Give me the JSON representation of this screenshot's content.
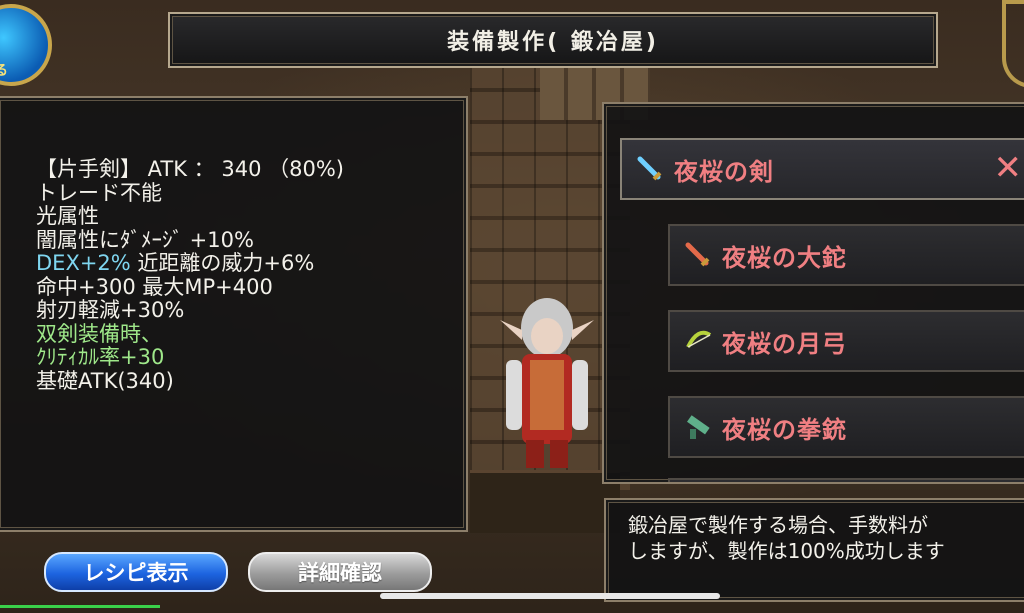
{
  "header": {
    "title": "装備製作( 鍛冶屋)"
  },
  "back_button": {
    "label": "る"
  },
  "item_info": {
    "lines": [
      {
        "text": "【片手剣】 ATK ： 340 （80%)",
        "color": "white"
      },
      {
        "text": "トレード不能",
        "color": "white"
      },
      {
        "text": "光属性",
        "color": "white"
      },
      {
        "text": "闇属性にﾀﾞﾒｰｼﾞ +10%",
        "color": "white"
      },
      {
        "text_a": "DEX+2%",
        "text_b": " 近距離の威力+6%",
        "color": "cyan+white"
      },
      {
        "text": "命中+300 最大MP+400",
        "color": "white"
      },
      {
        "text": "射刃軽減+30%",
        "color": "white"
      },
      {
        "text": "双剣装備時、",
        "color": "green"
      },
      {
        "text": "ｸﾘﾃｨｶﾙ率+30",
        "color": "green"
      },
      {
        "text": "基礎ATK(340)",
        "color": "white"
      }
    ]
  },
  "recipe_list": {
    "items": [
      {
        "label": "夜桜の剣",
        "icon": "sword-icon",
        "selected": true
      },
      {
        "label": "夜桜の大鉈",
        "icon": "great-sword-icon",
        "selected": false
      },
      {
        "label": "夜桜の月弓",
        "icon": "bow-icon",
        "selected": false
      },
      {
        "label": "夜桜の拳銃",
        "icon": "gun-icon",
        "selected": false
      }
    ],
    "close_symbol": "✕"
  },
  "message": {
    "line1": "鍛冶屋で製作する場合、手数料が",
    "line2": "しますが、製作は100%成功します"
  },
  "buttons": {
    "recipe": "レシピ表示",
    "detail": "詳細確認"
  },
  "colors": {
    "item_name": "#f07f82",
    "stat_cyan": "#7fd6f0",
    "stat_green": "#9fe88a",
    "recipe_button": "#1d64e0",
    "detail_button": "#9c9c9c"
  }
}
